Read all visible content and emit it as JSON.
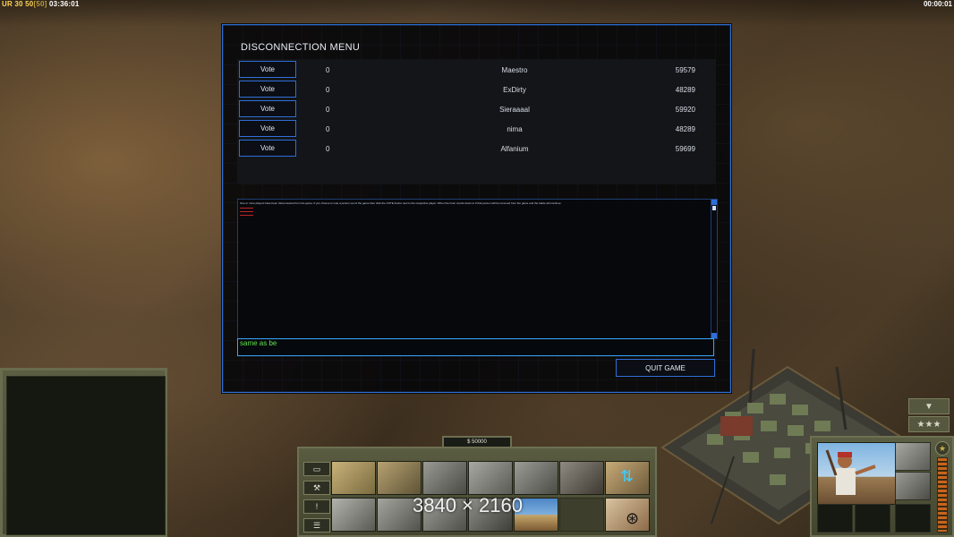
{
  "hud": {
    "ur_label": "UR",
    "fps_a": "30",
    "fps_b": "50",
    "fps_c": "[50]",
    "game_time": "03:36:01",
    "timer_right": "00:00:01"
  },
  "dialog": {
    "title": "DISCONNECTION MENU",
    "players": [
      {
        "vote": "Vote",
        "votes": "0",
        "name": "Maestro",
        "ping": "59579"
      },
      {
        "vote": "Vote",
        "votes": "0",
        "name": "ExDirty",
        "ping": "48289"
      },
      {
        "vote": "Vote",
        "votes": "0",
        "name": "Sieraaaal",
        "ping": "59920"
      },
      {
        "vote": "Vote",
        "votes": "0",
        "name": "nima",
        "ping": "48289"
      },
      {
        "vote": "Vote",
        "votes": "0",
        "name": "Alfanium",
        "ping": "59699"
      }
    ],
    "message": "One or more players have been disconnected from the game. If you choose to vote a person out of the game then click the VOTE button next to the respective player. When the timer counts down to 0 that person will be removed from the game and the battle will continue.",
    "chat_value": "same as be",
    "quit_label": "QUIT GAME"
  },
  "command_bar": {
    "money": "$ 50000",
    "watermark": "3840 × 2160"
  },
  "colors": {
    "accent_blue": "#2f6ed8",
    "chat_green": "#62e24d",
    "panel_olive": "#5a5c41"
  }
}
